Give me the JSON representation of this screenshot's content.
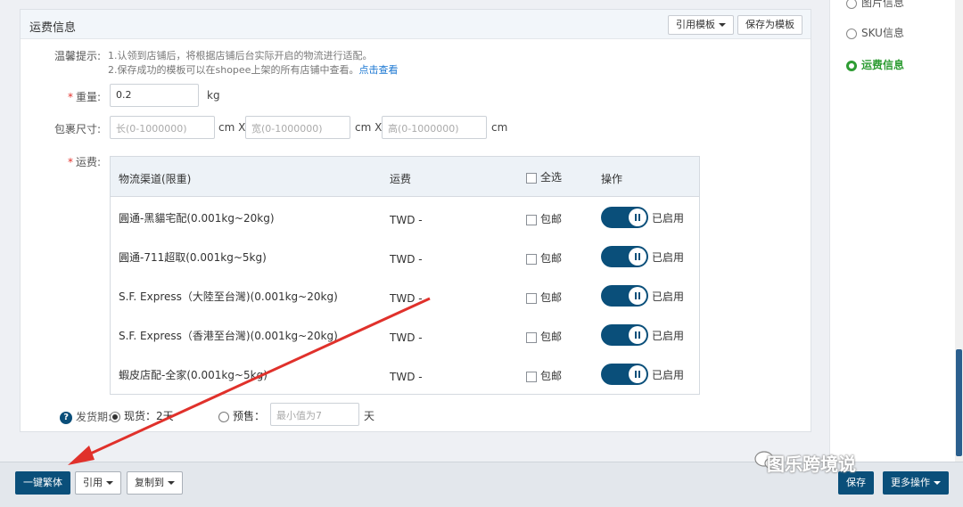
{
  "section": {
    "title": "运费信息",
    "ref_template_label": "引用模板",
    "save_template_label": "保存为模板"
  },
  "tips": {
    "label": "温馨提示:",
    "line1": "1.认领到店铺后，将根据店铺后台实际开启的物流进行适配。",
    "line2": "2.保存成功的模板可以在shopee上架的所有店铺中查看。",
    "line2_link": "点击查看"
  },
  "weight": {
    "label": "重量:",
    "value": "0.2",
    "unit": "kg"
  },
  "size": {
    "label": "包裹尺寸:",
    "length_placeholder": "长(0-1000000)",
    "width_placeholder": "宽(0-1000000)",
    "height_placeholder": "高(0-1000000)",
    "unit_x": "cm X",
    "unit": "cm"
  },
  "shipping": {
    "label": "运费:",
    "headers": {
      "channel": "物流渠道(限重)",
      "fee": "运费",
      "select_all": "全选",
      "action": "操作"
    },
    "rows": [
      {
        "channel": "圓通-黑貓宅配(0.001kg~20kg)",
        "fee": "TWD -",
        "free_label": "包邮",
        "status": "已启用"
      },
      {
        "channel": "圓通-711超取(0.001kg~5kg)",
        "fee": "TWD -",
        "free_label": "包邮",
        "status": "已启用"
      },
      {
        "channel": "S.F. Express（大陸至台灣)(0.001kg~20kg)",
        "fee": "TWD -",
        "free_label": "包邮",
        "status": "已启用"
      },
      {
        "channel": "S.F. Express（香港至台灣)(0.001kg~20kg)",
        "fee": "TWD -",
        "free_label": "包邮",
        "status": "已启用"
      },
      {
        "channel": "蝦皮店配-全家(0.001kg~5kg)",
        "fee": "TWD -",
        "free_label": "包邮",
        "status": "已启用"
      }
    ]
  },
  "ship_period": {
    "label": "发货期:",
    "in_stock": "现货：2天",
    "presale": "预售：",
    "presale_placeholder": "最小值为7",
    "unit": "天"
  },
  "footer": {
    "one_click": "一键繁体",
    "quote": "引用",
    "copy_to": "复制到",
    "save": "保存",
    "more": "更多操作"
  },
  "sidebar": {
    "items": [
      {
        "label": "图片信息"
      },
      {
        "label": "SKU信息"
      },
      {
        "label": "运费信息"
      }
    ]
  },
  "watermark": "图乐跨境说",
  "colors": {
    "primary": "#0a4f7a",
    "active_green": "#2e9c33",
    "required": "#e3322d",
    "arrow": "#e0312b"
  }
}
